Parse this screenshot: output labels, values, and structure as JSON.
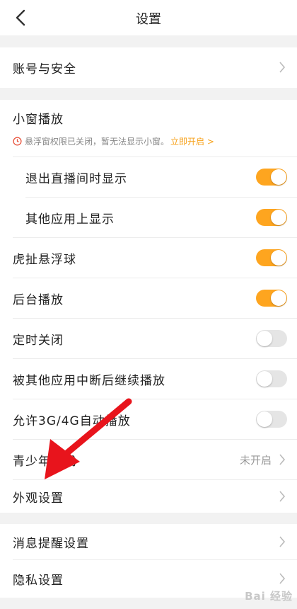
{
  "header": {
    "title": "设置"
  },
  "account": {
    "label": "账号与安全"
  },
  "pip": {
    "title": "小窗播放",
    "warning_text": "悬浮窗权限已关闭，暂无法显示小窗。",
    "warning_action": "立即开启 >",
    "items": [
      {
        "label": "退出直播间时显示",
        "on": true
      },
      {
        "label": "其他应用上显示",
        "on": true
      }
    ]
  },
  "settings": [
    {
      "label": "虎扯悬浮球",
      "on": true
    },
    {
      "label": "后台播放",
      "on": true
    },
    {
      "label": "定时关闭",
      "on": false
    },
    {
      "label": "被其他应用中断后继续播放",
      "on": false
    },
    {
      "label": "允许3G/4G自动播放",
      "on": false
    }
  ],
  "teen_mode": {
    "label": "青少年模式",
    "value": "未开启"
  },
  "appearance": {
    "label": "外观设置"
  },
  "notify": {
    "label": "消息提醒设置"
  },
  "privacy": {
    "label": "隐私设置"
  },
  "watermark": "Bai 经验",
  "colors": {
    "accent": "#fea51f",
    "arrow": "#e8141c"
  }
}
